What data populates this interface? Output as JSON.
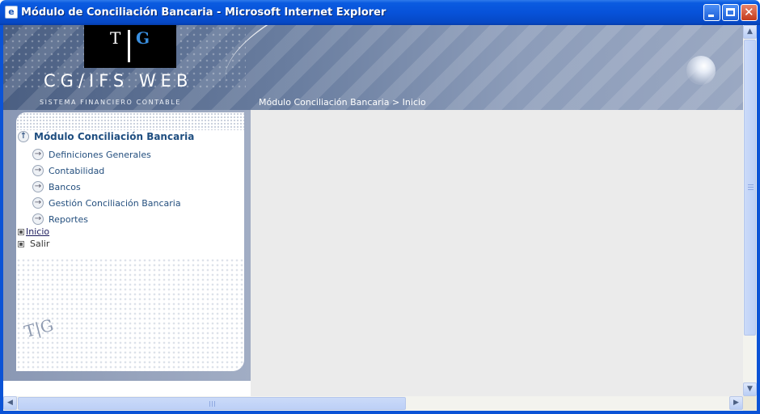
{
  "window": {
    "title": "Módulo de Conciliación Bancaria - Microsoft Internet Explorer",
    "icon": "ie-page-icon",
    "minimize": "minimize-button",
    "maximize": "maximize-button",
    "close": "close-button"
  },
  "header": {
    "logo_t": "T",
    "logo_g": "G",
    "app_name": "CG/IFS WEB",
    "subtitle": "Sistema Financiero Contable",
    "breadcrumb": "Módulo Conciliación Bancaria > Inicio"
  },
  "sidebar": {
    "main_item": "Módulo Conciliación Bancaria",
    "main_icon": "up-arrow-circle-icon",
    "submenu": [
      {
        "label": "Definiciones Generales",
        "icon": "right-arrow-circle-icon"
      },
      {
        "label": "Contabilidad",
        "icon": "right-arrow-circle-icon"
      },
      {
        "label": "Bancos",
        "icon": "right-arrow-circle-icon"
      },
      {
        "label": "Gestión Conciliación Bancaria",
        "icon": "right-arrow-circle-icon"
      },
      {
        "label": "Reportes",
        "icon": "right-arrow-circle-icon"
      }
    ],
    "links": [
      {
        "label": "Inicio"
      },
      {
        "label": "Salir"
      }
    ],
    "panel_logo_t": "T",
    "panel_logo_g": "G"
  },
  "colors": {
    "titlebar": "#0752d9",
    "header": "#6a7ea0",
    "menu_text": "#244f7e",
    "content_bg": "#ebebeb"
  }
}
